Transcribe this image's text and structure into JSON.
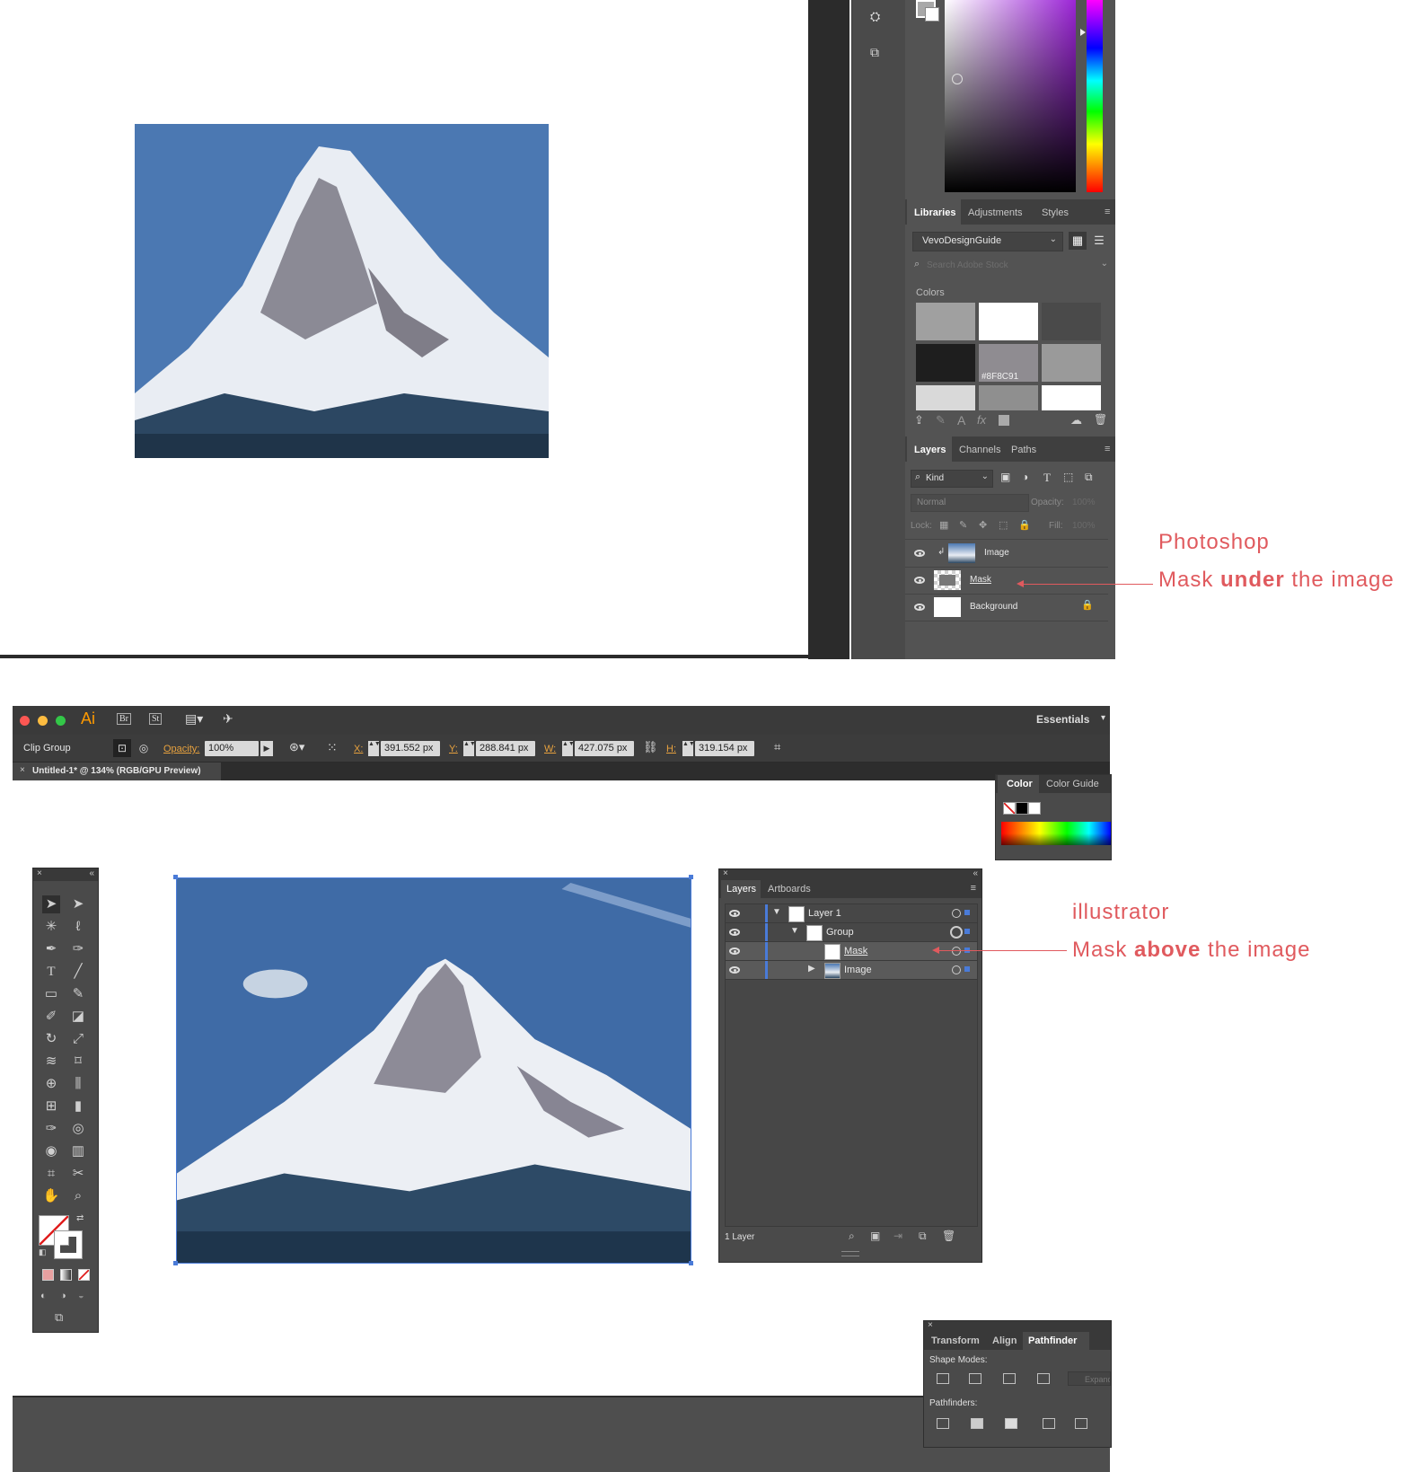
{
  "photoshop": {
    "tabs_libraries": [
      "Libraries",
      "Adjustments",
      "Styles"
    ],
    "library_name": "VevoDesignGuide",
    "search_placeholder": "Search Adobe Stock",
    "colors_label": "Colors",
    "swatch_hex_label": "#8F8C91",
    "tabs_layers": [
      "Layers",
      "Channels",
      "Paths"
    ],
    "kind_label": "Kind",
    "blend_mode": "Normal",
    "opacity_label": "Opacity:",
    "opacity_value": "100%",
    "lock_label": "Lock:",
    "fill_label": "Fill:",
    "fill_value": "100%",
    "layers": [
      "Image",
      "Mask",
      "Background"
    ],
    "swatch_colors": [
      "#a0a0a0",
      "#ffffff",
      "#4a4a4a",
      "#1e1e1e",
      "#8f8c91",
      "#9a9a9a",
      "#d9d9d9",
      "#8f8f8f",
      "#ffffff"
    ]
  },
  "annotations": {
    "ps_title": "Photoshop",
    "ps_line_pre": "Mask ",
    "ps_line_bold": "under",
    "ps_line_post": " the image",
    "ai_title": "illustrator",
    "ai_line_pre": "Mask ",
    "ai_line_bold": "above",
    "ai_line_post": " the image",
    "color": "#e05a5e"
  },
  "illustrator": {
    "app_logo": "Ai",
    "bridge_btn": "Br",
    "stock_btn": "St",
    "workspace": "Essentials",
    "selection_type": "Clip Group",
    "opacity_label": "Opacity:",
    "opacity_value": "100%",
    "x_label": "X:",
    "x_value": "391.552 px",
    "y_label": "Y:",
    "y_value": "288.841 px",
    "w_label": "W:",
    "w_value": "427.075 px",
    "h_label": "H:",
    "h_value": "319.154 px",
    "doc_tab": "Untitled-1* @ 134% (RGB/GPU Preview)",
    "color_tabs": [
      "Color",
      "Color Guide"
    ],
    "layers_tabs": [
      "Layers",
      "Artboards"
    ],
    "layers": [
      "Layer 1",
      "Group",
      "Mask",
      "Image"
    ],
    "layers_count": "1 Layer",
    "pathfinder_tabs": [
      "Transform",
      "Align",
      "Pathfinder"
    ],
    "shape_modes_label": "Shape Modes:",
    "pathfinders_label": "Pathfinders:",
    "expand_btn": "Expand"
  }
}
